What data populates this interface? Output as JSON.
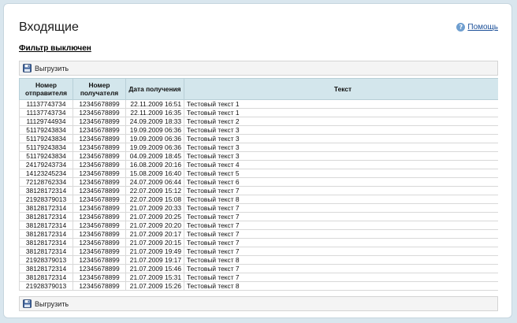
{
  "header": {
    "title": "Входящие",
    "help_label": "Помощь",
    "help_icon_glyph": "?"
  },
  "filter": {
    "label": "Фильтр выключен"
  },
  "toolbar": {
    "export_label": "Выгрузить",
    "export_icon": "floppy-disk-icon"
  },
  "table": {
    "columns": [
      "Номер отправителя",
      "Номер получателя",
      "Дата получения",
      "Текст"
    ],
    "rows": [
      [
        "11137743734",
        "12345678899",
        "22.11.2009 16:51",
        "Тестовый текст 1"
      ],
      [
        "11137743734",
        "12345678899",
        "22.11.2009 16:35",
        "Тестовый текст 1"
      ],
      [
        "11129744934",
        "12345678899",
        "24.09.2009 18:33",
        "Тестовый текст 2"
      ],
      [
        "51179243834",
        "12345678899",
        "19.09.2009 06:36",
        "Тестовый текст 3"
      ],
      [
        "51179243834",
        "12345678899",
        "19.09.2009 06:36",
        "Тестовый текст 3"
      ],
      [
        "51179243834",
        "12345678899",
        "19.09.2009 06:36",
        "Тестовый текст 3"
      ],
      [
        "51179243834",
        "12345678899",
        "04.09.2009 18:45",
        "Тестовый текст 3"
      ],
      [
        "24179243734",
        "12345678899",
        "16.08.2009 20:16",
        "Тестовый текст 4"
      ],
      [
        "14123245234",
        "12345678899",
        "15.08.2009 16:40",
        "Тестовый текст 5"
      ],
      [
        "72128762334",
        "12345678899",
        "24.07.2009 06:44",
        "Тестовый текст 6"
      ],
      [
        "38128172314",
        "12345678899",
        "22.07.2009 15:12",
        "Тестовый текст 7"
      ],
      [
        "21928379013",
        "12345678899",
        "22.07.2009 15:08",
        "Тестовый текст 8"
      ],
      [
        "38128172314",
        "12345678899",
        "21.07.2009 20:33",
        "Тестовый текст 7"
      ],
      [
        "38128172314",
        "12345678899",
        "21.07.2009 20:25",
        "Тестовый текст 7"
      ],
      [
        "38128172314",
        "12345678899",
        "21.07.2009 20:20",
        "Тестовый текст 7"
      ],
      [
        "38128172314",
        "12345678899",
        "21.07.2009 20:17",
        "Тестовый текст 7"
      ],
      [
        "38128172314",
        "12345678899",
        "21.07.2009 20:15",
        "Тестовый текст 7"
      ],
      [
        "38128172314",
        "12345678899",
        "21.07.2009 19:49",
        "Тестовый текст 7"
      ],
      [
        "21928379013",
        "12345678899",
        "21.07.2009 19:17",
        "Тестовый текст 8"
      ],
      [
        "38128172314",
        "12345678899",
        "21.07.2009 15:46",
        "Тестовый текст 7"
      ],
      [
        "38128172314",
        "12345678899",
        "21.07.2009 15:31",
        "Тестовый текст 7"
      ],
      [
        "21928379013",
        "12345678899",
        "21.07.2009 15:26",
        "Тестовый текст 8"
      ]
    ]
  },
  "colors": {
    "header_bg": "#d3e6ec",
    "link": "#1b4f98",
    "page_bg": "#d9e6ee"
  }
}
